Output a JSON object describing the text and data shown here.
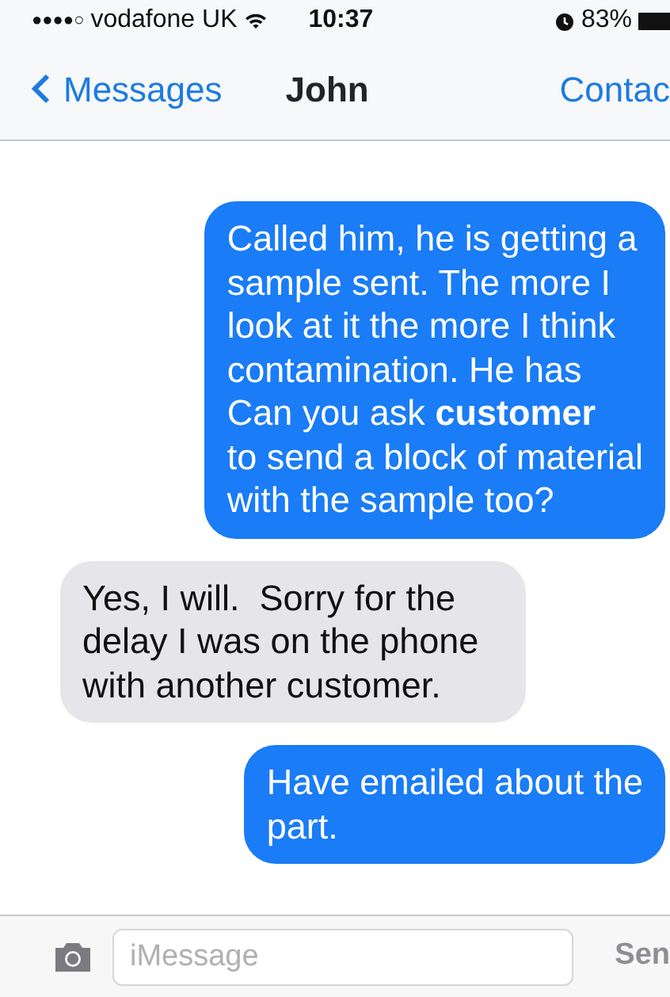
{
  "status_bar": {
    "signal": "●●●●○",
    "carrier": "vodafone UK",
    "time": "10:37",
    "battery_percent": "83%"
  },
  "nav_bar": {
    "back": "Messages",
    "title": "John",
    "action": "Contac"
  },
  "messages": [
    {
      "kind": "sent",
      "text": "Called him, he is getting a\nsample sent. The more I\nlook at it the more I think\ncontamination. He has\nCan you ask **customer**\nto send a block of material\nwith the sample too?"
    },
    {
      "kind": "received",
      "text": "Yes, I will.  Sorry for the\ndelay I was on the phone\nwith another customer."
    },
    {
      "kind": "sent",
      "text": "Have emailed about the\npart."
    }
  ],
  "compose": {
    "placeholder": "iMessage",
    "send": "Sen"
  }
}
